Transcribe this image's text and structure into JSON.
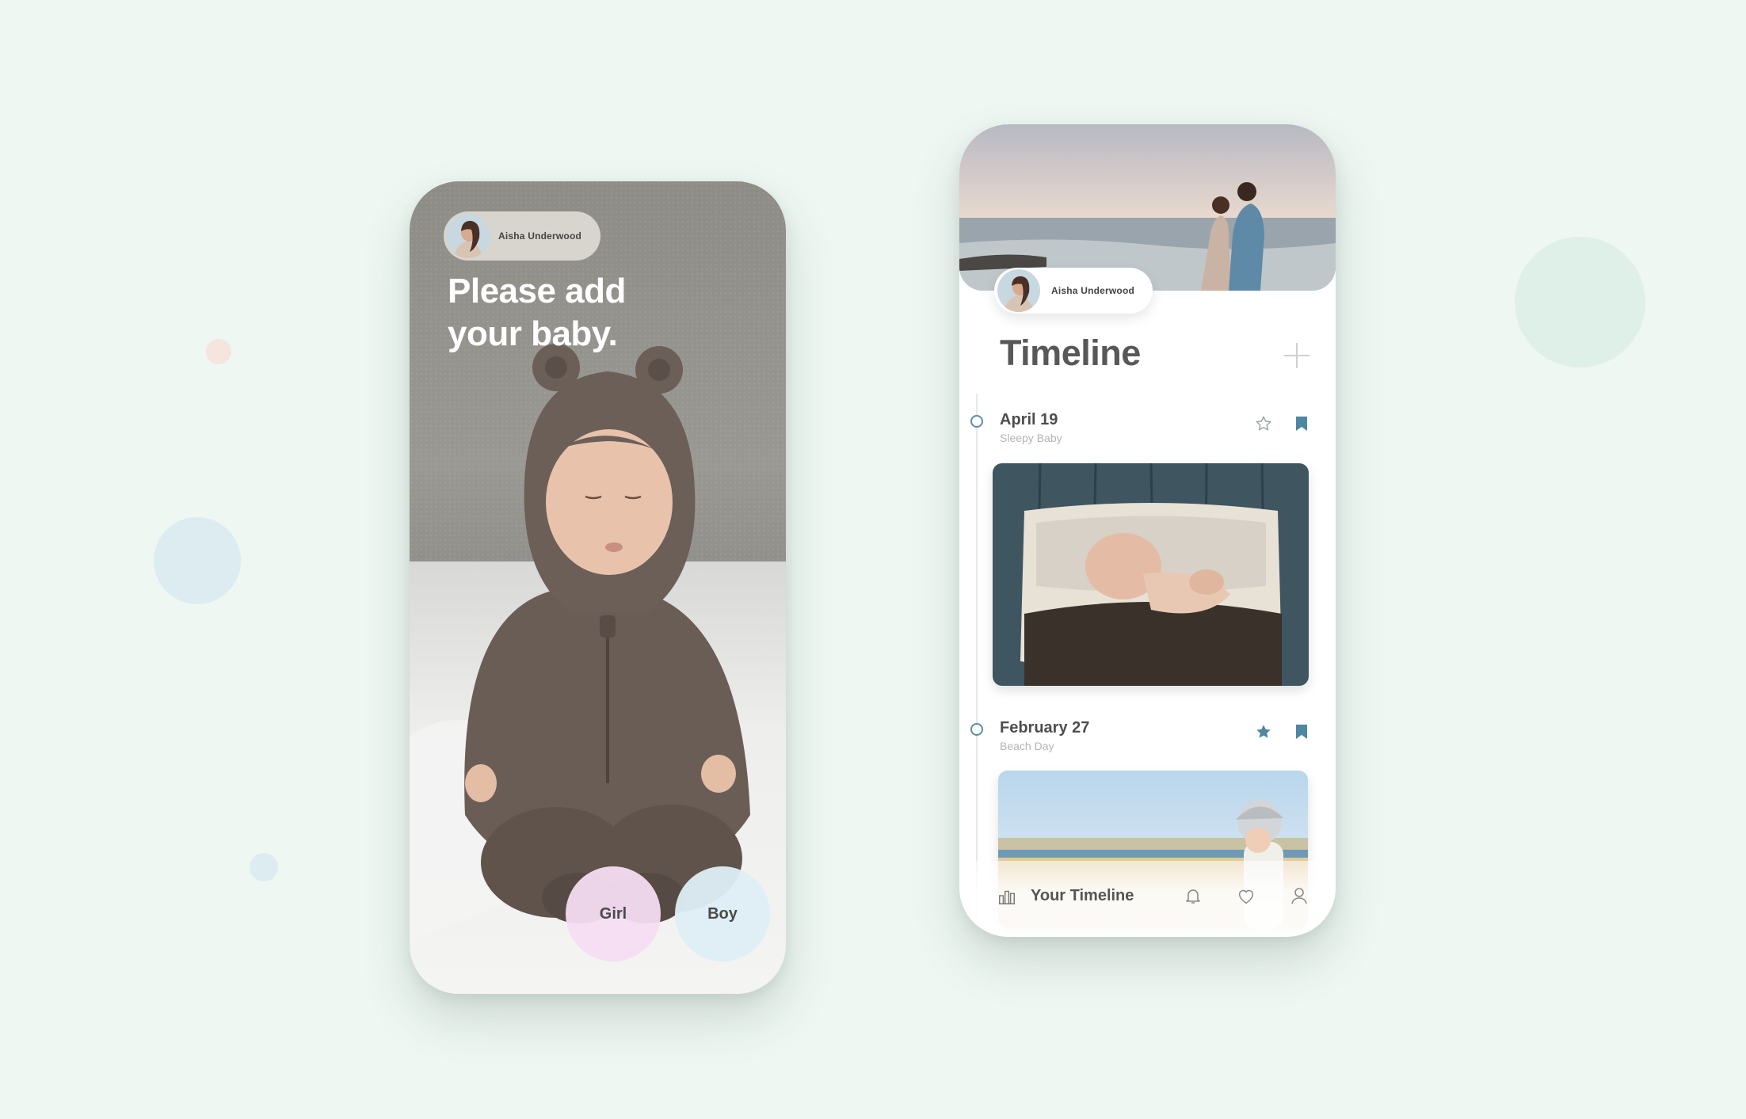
{
  "colors": {
    "background": "#eef7f2",
    "accent_blue": "#4f86a1",
    "girl_pink": "#f6dcf2",
    "boy_blue": "#deeef5"
  },
  "add_baby_screen": {
    "user_name": "Aisha Underwood",
    "headline_line1": "Please add",
    "headline_line2": "your baby.",
    "girl_label": "Girl",
    "boy_label": "Boy"
  },
  "timeline_screen": {
    "user_name": "Aisha Underwood",
    "title": "Timeline",
    "add_icon": "plus-icon",
    "entries": [
      {
        "date": "April 19",
        "caption": "Sleepy Baby",
        "starred": false,
        "bookmarked": true
      },
      {
        "date": "February 27",
        "caption": "Beach Day",
        "starred": true,
        "bookmarked": true
      }
    ],
    "bottom_nav": {
      "active_label": "Your Timeline",
      "icons": [
        "timeline-icon",
        "bell-icon",
        "heart-icon",
        "profile-icon"
      ]
    }
  }
}
